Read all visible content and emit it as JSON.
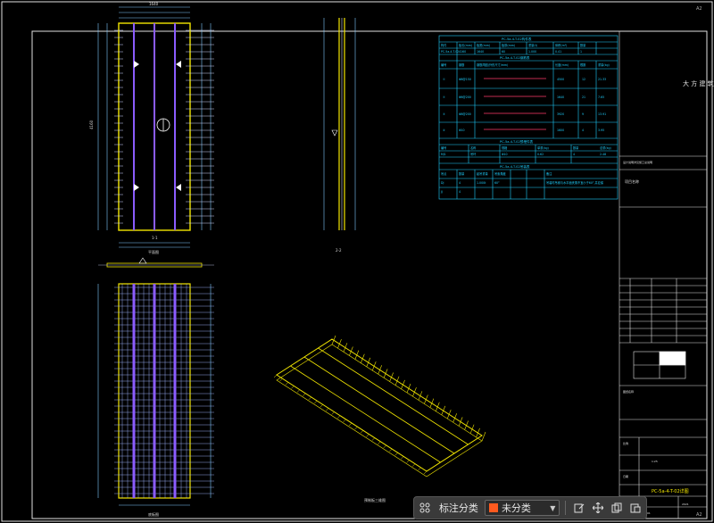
{
  "sheet": {
    "corner_tag_top": "A2",
    "corner_tag_bottom": "A2"
  },
  "views": {
    "plan_title": "平面图",
    "section_label_1": "1-1",
    "section_label_2": "2-2",
    "bottom_view_title": "底板图",
    "iso_title": "预制板三维图",
    "dim_total_w": "1640",
    "dim_total_h": "4160"
  },
  "schedule": {
    "title_main": "PC-5a-4-T-02构件表",
    "header": [
      "构件",
      "板长(mm)",
      "板宽(mm)",
      "板厚(mm)",
      "重量(t)",
      "体积(m³)",
      "数量"
    ],
    "main_row": [
      "PC-5a-4-T-02",
      "4160",
      "1640",
      "60",
      "1.000",
      "0.41",
      "1"
    ],
    "title_rebar": "PC-5a-4-T-02钢筋表",
    "rebar_header": [
      "编号",
      "钢筋",
      "钢筋简图(外形尺寸/mm)",
      "长度(mm)",
      "根数",
      "重量(kg)"
    ],
    "rebar_rows": [
      {
        "mark": "①",
        "spec": "Φ8@150",
        "length": "4500",
        "count": "12",
        "weight": "21.33"
      },
      {
        "mark": "②",
        "spec": "Φ6@200",
        "length": "1640",
        "count": "21",
        "weight": "7.65"
      },
      {
        "mark": "③",
        "spec": "Φ8@200",
        "length": "3920",
        "count": "9",
        "weight": "13.91"
      },
      {
        "mark": "④",
        "spec": "Φ10",
        "length": "1600",
        "count": "4",
        "weight": "3.95"
      }
    ],
    "title_embed": "PC-5a-4-T-02预埋件表",
    "embed_header": [
      "编号",
      "名称",
      "规格",
      "单重(kg)",
      "数量",
      "总重(kg)"
    ],
    "embed_rows": [
      [
        "MJ1",
        "吊环",
        "Φ10",
        "0.62",
        "4",
        "2.48"
      ]
    ],
    "title_lift": "PC-5a-4-T-02吊装表",
    "lift_header": [
      "吊点",
      "数量",
      "起吊重量",
      "吊索角度",
      "备注"
    ],
    "lift_rows": [
      [
        "DJ",
        "4",
        "1.000t",
        "60°",
        "吊装时吊索与水平面夹角不宜小于60°,并应保证各吊点受力均匀"
      ],
      [
        "JJ",
        "4",
        "",
        "",
        ""
      ]
    ]
  },
  "title_block": {
    "company": "大 方 建 筑",
    "project_label": "项目名称",
    "drawing_label": "图纸名称",
    "note_line": "设计说明详见施工总说明",
    "drawing_name": "PC-5a-4-T-02详图",
    "scale_label": "比例",
    "scale_value": "1:25",
    "date_label": "日期",
    "date_value": "2021",
    "sheet_no_label": "图号",
    "sheet_no_value": "PC-01"
  },
  "toolbar": {
    "label": "标注分类",
    "category_value": "未分类",
    "swatch_color": "#ff5a1f",
    "icons": [
      "grid-icon",
      "edit-icon",
      "move-icon",
      "copy-icon",
      "paste-icon"
    ]
  }
}
